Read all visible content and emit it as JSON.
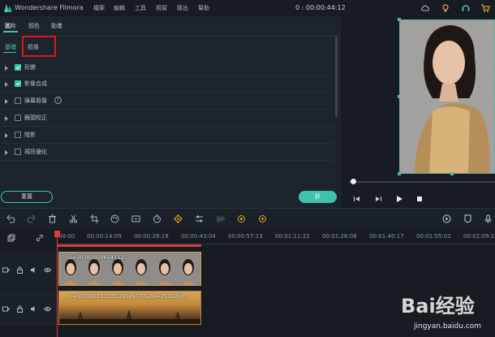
{
  "window": {
    "app_name": "Wondershare Filmora",
    "menus": [
      "檔案",
      "編輯",
      "工具",
      "視窗",
      "匯出",
      "幫助"
    ],
    "timecode": "0 : 00:00:44:12",
    "icons": [
      "cloud-icon",
      "bulb-icon",
      "headset-icon",
      "cart-icon"
    ]
  },
  "edit_panel": {
    "tabs": [
      "圖片",
      "顏色",
      "動畫"
    ],
    "active_tab": "圖片",
    "subtabs": [
      "基礎",
      "摳像"
    ],
    "active_subtab": "基礎",
    "highlighted_subtab": "摳像",
    "properties": [
      {
        "label": "形變",
        "checked": true
      },
      {
        "label": "影像合成",
        "checked": true
      },
      {
        "label": "綠幕摳像",
        "checked": false,
        "help": "?"
      },
      {
        "label": "鏡頭校正",
        "checked": false
      },
      {
        "label": "陰影",
        "checked": false
      },
      {
        "label": "視訊優化",
        "checked": false
      }
    ],
    "reset_label": "重置",
    "ok_label": "好",
    "accent_color": "#3fc1ab",
    "highlight_color": "#d8181e"
  },
  "preview": {
    "controls": [
      "prev-frame-icon",
      "play-pause-icon",
      "play-icon",
      "stop-icon"
    ],
    "progress": 0.0
  },
  "toolbar": {
    "icons": [
      "undo-icon",
      "redo-icon",
      "delete-icon",
      "cut-icon",
      "crop-icon",
      "color-icon",
      "snapshot-icon",
      "speed-icon",
      "keyframe-icon",
      "adjust-icon",
      "audio-mix-icon",
      "motion-track-icon",
      "stabilize-icon",
      "render-icon",
      "marker-icon",
      "mic-icon"
    ]
  },
  "timeline": {
    "ruler": [
      "00:00",
      "00:00:14:09",
      "00:00:28:18",
      "00:00:43:04",
      "00:00:57:13",
      "00:01:11:22",
      "00:01:26:08",
      "00:01:40:17",
      "00:01:55:02",
      "00:02:09:12"
    ],
    "clip_video": "u=20160920654152...",
    "clip_background": "u=3538031531,3526589570&fm=253&fmt..."
  },
  "watermark": {
    "logo": "Bai经验",
    "site": "jingyan.baidu.com"
  }
}
